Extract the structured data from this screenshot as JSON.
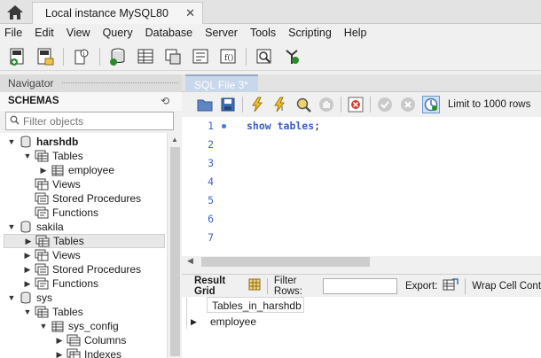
{
  "window": {
    "tab_title": "Local instance MySQL80",
    "close_glyph": "✕"
  },
  "menu": [
    "File",
    "Edit",
    "View",
    "Query",
    "Database",
    "Server",
    "Tools",
    "Scripting",
    "Help"
  ],
  "navigator": {
    "header": "Navigator",
    "schemas_label": "SCHEMAS",
    "filter_placeholder": "Filter objects",
    "tree": [
      {
        "label": "harshdb",
        "bold": true
      },
      {
        "label": "Tables"
      },
      {
        "label": "employee"
      },
      {
        "label": "Views"
      },
      {
        "label": "Stored Procedures"
      },
      {
        "label": "Functions"
      },
      {
        "label": "sakila"
      },
      {
        "label": "Tables"
      },
      {
        "label": "Views"
      },
      {
        "label": "Stored Procedures"
      },
      {
        "label": "Functions"
      },
      {
        "label": "sys"
      },
      {
        "label": "Tables"
      },
      {
        "label": "sys_config"
      },
      {
        "label": "Columns"
      },
      {
        "label": "Indexes"
      }
    ]
  },
  "editor": {
    "tab_label": "SQL File 3*",
    "limit_label": "Limit to 1000 rows",
    "line_numbers": [
      "1",
      "2",
      "3",
      "4",
      "5",
      "6",
      "7"
    ],
    "code_keyword": "show tables",
    "code_terminator": ";"
  },
  "results": {
    "result_grid_label": "Result Grid",
    "filter_rows_label": "Filter Rows:",
    "export_label": "Export:",
    "wrap_label": "Wrap Cell Cont",
    "column_header": "Tables_in_harshdb",
    "rows": [
      "employee"
    ]
  },
  "colors": {
    "accent_blue": "#3c64d2",
    "tab_active": "#c9d7ea"
  }
}
